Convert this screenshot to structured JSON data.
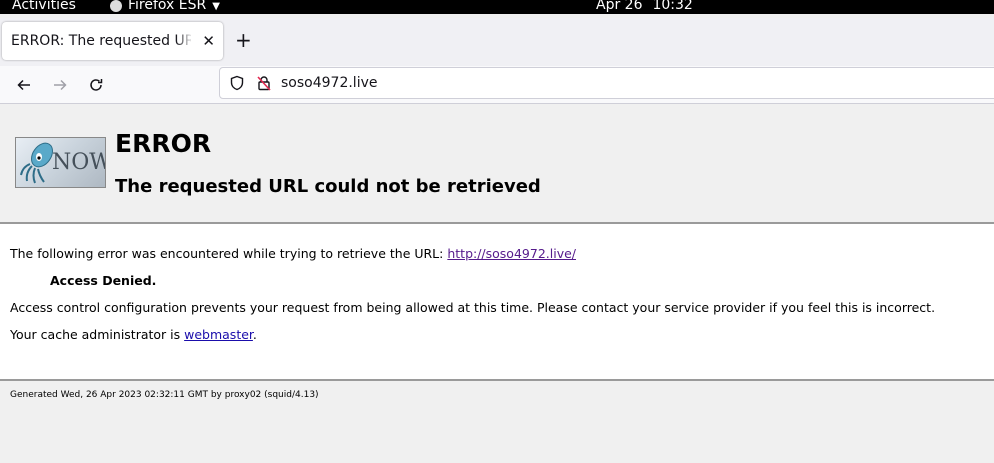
{
  "topbar": {
    "activities": "Activities",
    "app_name": "Firefox ESR",
    "date": "Apr 26",
    "time": "10:32"
  },
  "tab": {
    "title": "ERROR: The requested URL could not be retrieved"
  },
  "urlbar": {
    "url": "soso4972.live"
  },
  "page": {
    "logo_text": "NOW",
    "title": "ERROR",
    "subtitle": "The requested URL could not be retrieved",
    "intro": "The following error was encountered while trying to retrieve the URL: ",
    "intro_link": "http://soso4972.live/",
    "denied": "Access Denied.",
    "explanation": "Access control configuration prevents your request from being allowed at this time. Please contact your service provider if you feel this is incorrect.",
    "admin_prefix": "Your cache administrator is ",
    "admin_link": "webmaster",
    "admin_suffix": ".",
    "footer": "Generated Wed, 26 Apr 2023 02:32:11 GMT by proxy02 (squid/4.13)"
  },
  "colors": {
    "link": "#1a0dab",
    "visited_link": "#551a8b",
    "page_bg": "#f0f0f0",
    "rule": "#9a9a9a"
  },
  "icons": [
    "firefox-icon",
    "caret-down-icon",
    "close-icon",
    "plus-icon",
    "back-arrow-icon",
    "forward-arrow-icon",
    "reload-icon",
    "shield-icon",
    "insecure-lock-icon",
    "squid-logo"
  ]
}
